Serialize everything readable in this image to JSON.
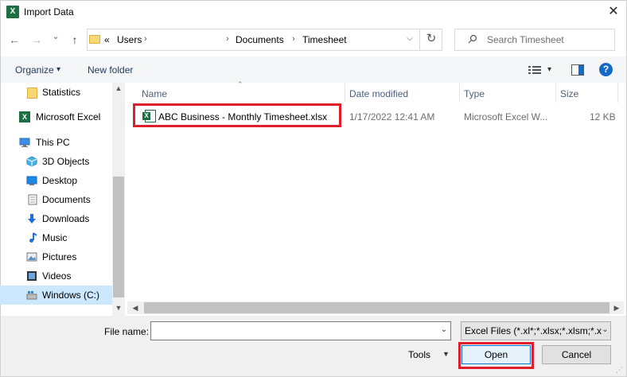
{
  "window": {
    "title": "Import Data",
    "app_icon": "excel-icon",
    "close_glyph": "✕"
  },
  "nav_buttons": {
    "back": "←",
    "forward": "→",
    "recent": "⌄",
    "up": "↑"
  },
  "address": {
    "overflow": "«",
    "crumbs": [
      "Users",
      "Documents",
      "Timesheet"
    ],
    "separator": "›",
    "refresh": "↻"
  },
  "search": {
    "placeholder": "Search Timesheet"
  },
  "toolbar": {
    "organize": "Organize",
    "organize_caret": "▾",
    "new_folder": "New folder",
    "view_caret": "▾",
    "help": "?"
  },
  "nav_pane": {
    "items": [
      {
        "label": "Statistics",
        "icon": "folder-icon"
      },
      {
        "label": "Microsoft Excel",
        "icon": "excel-icon"
      },
      {
        "label": "This PC",
        "icon": "computer-icon"
      },
      {
        "label": "3D Objects",
        "icon": "cube-icon"
      },
      {
        "label": "Desktop",
        "icon": "desktop-icon"
      },
      {
        "label": "Documents",
        "icon": "document-icon"
      },
      {
        "label": "Downloads",
        "icon": "download-icon"
      },
      {
        "label": "Music",
        "icon": "music-icon"
      },
      {
        "label": "Pictures",
        "icon": "picture-icon"
      },
      {
        "label": "Videos",
        "icon": "video-icon"
      },
      {
        "label": "Windows (C:)",
        "icon": "drive-icon",
        "selected": true
      }
    ]
  },
  "file_list": {
    "columns": [
      "Name",
      "Date modified",
      "Type",
      "Size"
    ],
    "rows": [
      {
        "name": "ABC Business - Monthly Timesheet.xlsx",
        "date": "1/17/2022 12:41 AM",
        "type": "Microsoft Excel W...",
        "size": "12 KB",
        "icon": "xlsx-file-icon"
      }
    ]
  },
  "bottom": {
    "file_name_label": "File name:",
    "file_name_value": "",
    "filter": "Excel Files (*.xl*;*.xlsx;*.xlsm;*.x",
    "tools": "Tools",
    "open": "Open",
    "cancel": "Cancel"
  },
  "colors": {
    "highlight": "#e01e2b",
    "excel_green": "#1d6f42",
    "selection": "#cce8ff"
  }
}
